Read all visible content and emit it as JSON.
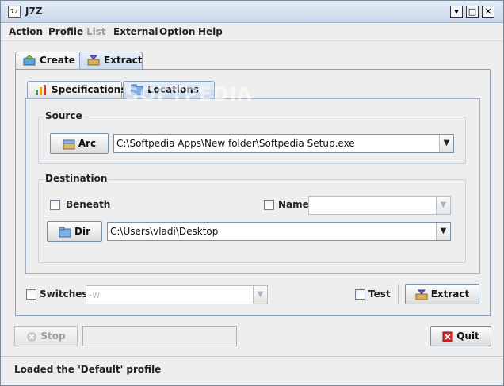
{
  "window": {
    "title": "J7Z",
    "app_icon_text": "7z"
  },
  "menu": [
    "Action",
    "Profile",
    "List",
    "External",
    "Option",
    "Help"
  ],
  "menu_disabled": [
    "List"
  ],
  "tabs": {
    "create": "Create",
    "extract": "Extract",
    "specifications": "Specifications",
    "locations": "Locations"
  },
  "watermark": "SOFTPEDIA",
  "source": {
    "title": "Source",
    "arc_button": "Arc",
    "archive_path": "C:\\Softpedia Apps\\New folder\\Softpedia Setup.exe"
  },
  "destination": {
    "title": "Destination",
    "beneath_label": "Beneath",
    "name_label": "Name",
    "name_value": "",
    "dir_button": "Dir",
    "dir_path": "C:\\Users\\vladi\\Desktop"
  },
  "bottom": {
    "switches_label": "Switches",
    "switches_value": "-w",
    "test_label": "Test",
    "extract_button": "Extract",
    "stop_button": "Stop",
    "quit_button": "Quit"
  },
  "status": "Loaded the 'Default' profile",
  "colors": {
    "accent": "#4a7ebb",
    "title_gradient_top": "#e3ecf7",
    "quit_icon": "#d42a2a"
  }
}
